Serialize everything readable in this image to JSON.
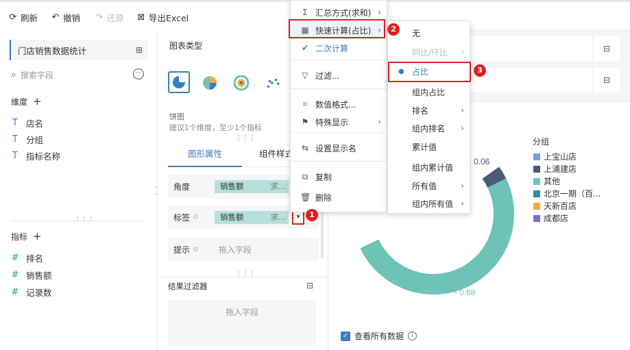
{
  "toolbar": {
    "refresh": "刷新",
    "undo": "撤销",
    "redo": "还原",
    "export": "导出Excel"
  },
  "left": {
    "dataset_name": "门店销售数据统计",
    "search_placeholder": "搜索字段",
    "dimensions_title": "维度",
    "dimensions": [
      "店名",
      "分组",
      "指标名称"
    ],
    "metrics_title": "指标",
    "metrics": [
      "排名",
      "销售额",
      "记录数"
    ]
  },
  "middle": {
    "chart_type_title": "图表类型",
    "chart_name": "饼图",
    "chart_hint": "建议1个维度，至少1个指标",
    "tab_graph": "图形属性",
    "tab_component": "组件样式",
    "rows": [
      {
        "label": "角度",
        "field": "销售额",
        "agg": "求..."
      },
      {
        "label": "标签",
        "field": "销售额",
        "agg": "求..."
      },
      {
        "label": "提示",
        "placeholder": "拖入字段"
      }
    ],
    "result_filter_title": "结果过滤器",
    "result_filter_placeholder": "拖入字段"
  },
  "chart": {
    "legend_title": "分组",
    "legend": [
      {
        "name": "上宝山店",
        "color": "#7b9be6"
      },
      {
        "name": "上浦建店",
        "color": "#4a5a78"
      },
      {
        "name": "其他",
        "color": "#6fc2b8"
      },
      {
        "name": "北京一期（百...",
        "color": "#2f8f9a"
      },
      {
        "name": "天新百店",
        "color": "#f2a93b"
      },
      {
        "name": "成都店",
        "color": "#7d6fc9"
      }
    ],
    "label_top": "0.06",
    "label_bottom": "0.68",
    "show_all_label": "查看所有数据"
  },
  "chart_data": {
    "type": "pie",
    "categories": [
      "其他"
    ],
    "values": [
      0.68
    ],
    "annotations": [
      "0.06",
      "0.68"
    ]
  },
  "context_menu": {
    "items": [
      {
        "icon": "Σ",
        "label": "汇总方式(求和)",
        "arrow": true
      },
      {
        "icon": "▦",
        "label": "快速计算(占比)",
        "arrow": true
      },
      {
        "icon": "✔",
        "label": "二次计算",
        "arrow": false
      },
      {
        "icon": "▽",
        "label": "过滤...",
        "arrow": false
      },
      {
        "icon": "⌗",
        "label": "数值格式...",
        "arrow": false
      },
      {
        "icon": "⚑",
        "label": "特殊显示",
        "arrow": true
      },
      {
        "icon": "⇆",
        "label": "设置显示名",
        "arrow": false
      },
      {
        "icon": "⧉",
        "label": "复制",
        "arrow": false
      },
      {
        "icon": "🗑",
        "label": "删除",
        "arrow": false
      }
    ]
  },
  "sub_menu": {
    "items": [
      {
        "label": "无",
        "arrow": false
      },
      {
        "label": "同比/环比",
        "arrow": true,
        "disabled": true
      },
      {
        "label": "占比",
        "arrow": false,
        "selected": true
      },
      {
        "label": "组内占比",
        "arrow": false
      },
      {
        "label": "排名",
        "arrow": true
      },
      {
        "label": "组内排名",
        "arrow": true
      },
      {
        "label": "累计值",
        "arrow": false
      },
      {
        "label": "组内累计值",
        "arrow": false
      },
      {
        "label": "所有值",
        "arrow": true
      },
      {
        "label": "组内所有值",
        "arrow": true
      }
    ]
  },
  "badges": [
    "1",
    "2",
    "3"
  ]
}
